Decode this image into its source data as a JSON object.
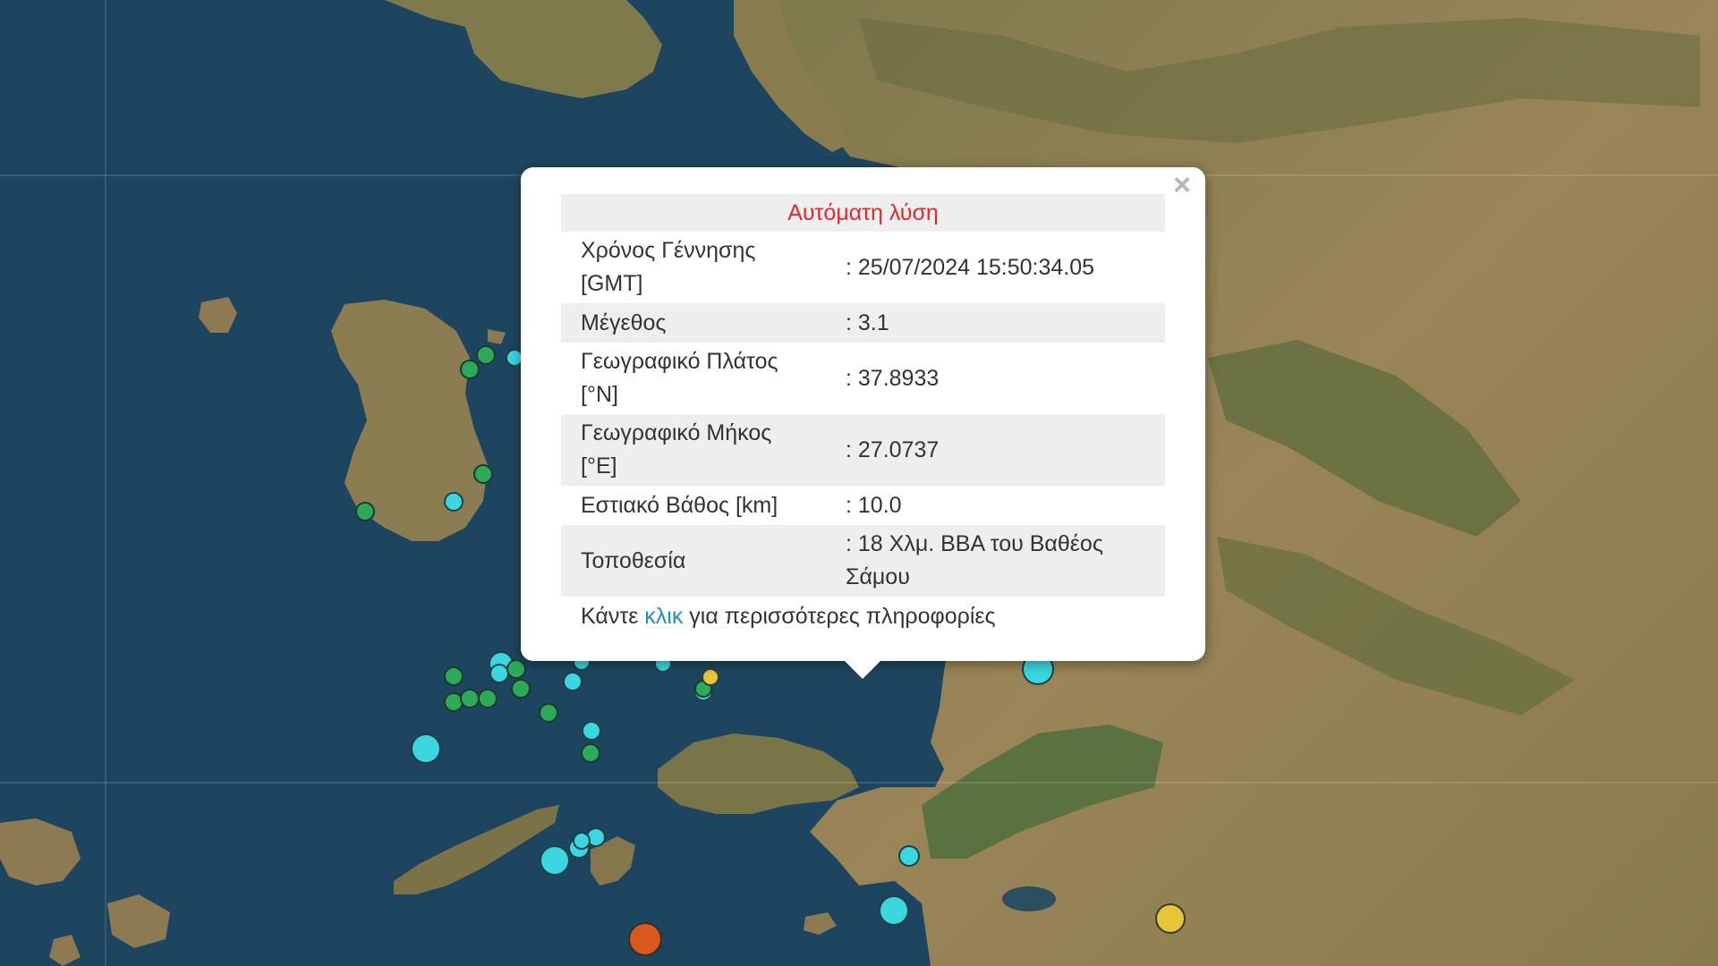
{
  "colors": {
    "sea": "#1e4560",
    "land": "#8a7a4e",
    "popup_title": "#e8262a",
    "link": "#1e90c8",
    "marker_green": "#2ea859",
    "marker_cyan": "#3bd6e0",
    "marker_yellow": "#e8c43a",
    "marker_orange": "#d9581e"
  },
  "popup": {
    "title": "Αυτόματη λύση",
    "close_symbol": "×",
    "rows": [
      {
        "label_line1": "Χρόνος Γέννησης",
        "label_line2": "[GMT]",
        "value_line1": ": 25/07/2024 15:50:34.05",
        "value_line2": ""
      },
      {
        "label_line1": "Μέγεθος",
        "label_line2": "",
        "value_line1": ": 3.1",
        "value_line2": ""
      },
      {
        "label_line1": "Γεωγραφικό Πλάτος",
        "label_line2": "[°N]",
        "value_line1": ": 37.8933",
        "value_line2": ""
      },
      {
        "label_line1": "Γεωγραφικό Μήκος",
        "label_line2": "[°E]",
        "value_line1": ": 27.0737",
        "value_line2": ""
      },
      {
        "label_line1": "Εστιακό Βάθος [km]",
        "label_line2": "",
        "value_line1": ": 10.0",
        "value_line2": ""
      },
      {
        "label_line1": "Τοποθεσία",
        "label_line2": "",
        "value_line1": ": 18 Χλμ. ΒΒΑ του Βαθέος",
        "value_line2": "Σάμου"
      }
    ],
    "footer_before": "Κάντε ",
    "footer_link": "κλικ",
    "footer_after": " για περισσότερες πληροφορίες"
  },
  "markers": [
    {
      "color": "green"
    },
    {
      "color": "green"
    },
    {
      "color": "cyan"
    },
    {
      "color": "green"
    },
    {
      "color": "green"
    },
    {
      "color": "cyan"
    },
    {
      "color": "green"
    },
    {
      "color": "cyan"
    },
    {
      "color": "cyan"
    },
    {
      "color": "green"
    },
    {
      "color": "green"
    },
    {
      "color": "green"
    },
    {
      "color": "green"
    },
    {
      "color": "green"
    },
    {
      "color": "green"
    },
    {
      "color": "green"
    },
    {
      "color": "cyan"
    },
    {
      "color": "cyan"
    },
    {
      "color": "cyan"
    },
    {
      "color": "cyan"
    },
    {
      "color": "cyan"
    },
    {
      "color": "green"
    },
    {
      "color": "cyan"
    },
    {
      "color": "yellow"
    },
    {
      "color": "cyan"
    },
    {
      "color": "cyan"
    },
    {
      "color": "cyan"
    },
    {
      "color": "cyan"
    },
    {
      "color": "cyan"
    },
    {
      "color": "cyan"
    },
    {
      "color": "cyan"
    },
    {
      "color": "orange"
    },
    {
      "color": "yellow"
    }
  ]
}
